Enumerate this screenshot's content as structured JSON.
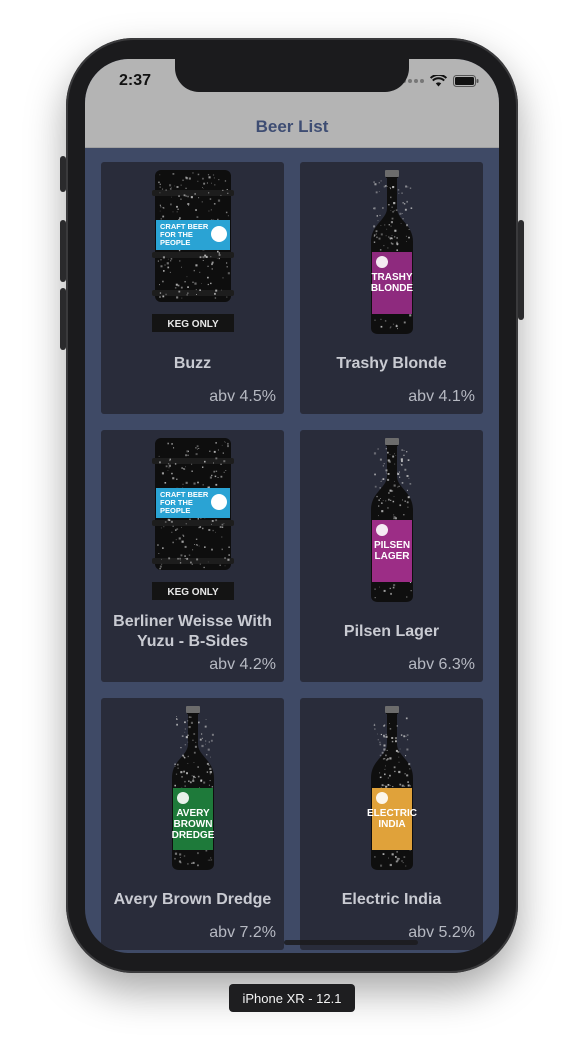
{
  "status_bar": {
    "time": "2:37"
  },
  "nav": {
    "title": "Beer List"
  },
  "beers": [
    {
      "name": "Buzz",
      "abv": "abv 4.5%",
      "image": "keg",
      "label_color": "#2aa3d4",
      "label_text": "CRAFT BEER FOR THE PEOPLE",
      "tag": "KEG ONLY"
    },
    {
      "name": "Trashy Blonde",
      "abv": "abv 4.1%",
      "image": "bottle",
      "label_color": "#8e2a7e",
      "label_text": "TRASHY BLONDE"
    },
    {
      "name": "Berliner Weisse With Yuzu - B-Sides",
      "abv": "abv 4.2%",
      "image": "keg",
      "label_color": "#2aa3d4",
      "label_text": "CRAFT BEER FOR THE PEOPLE",
      "tag": "KEG ONLY"
    },
    {
      "name": "Pilsen Lager",
      "abv": "abv 6.3%",
      "image": "bottle",
      "label_color": "#9c2d86",
      "label_text": "PILSEN LAGER"
    },
    {
      "name": "Avery Brown Dredge",
      "abv": "abv 7.2%",
      "image": "bottle",
      "label_color": "#1e7a3a",
      "label_text": "AVERY BROWN DREDGE"
    },
    {
      "name": "Electric India",
      "abv": "abv 5.2%",
      "image": "bottle",
      "label_color": "#e0a23a",
      "label_text": "ELECTRIC INDIA"
    }
  ],
  "device_label": "iPhone XR - 12.1",
  "colors": {
    "nav_background": "#b4b4b4",
    "nav_title": "#3e4d73",
    "list_background": "#3f4a66",
    "card_background": "#292c3a"
  }
}
